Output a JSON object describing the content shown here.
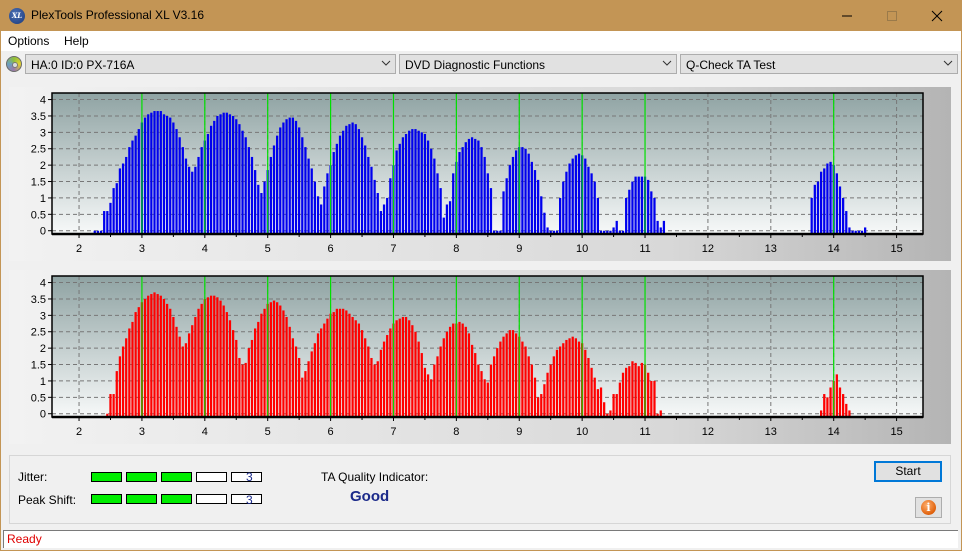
{
  "window": {
    "title": "PlexTools Professional XL V3.16",
    "icon": "plextools-xl-logo-icon",
    "icon_text": "XL",
    "controls": [
      "minimize-icon",
      "maximize-icon",
      "close-icon"
    ]
  },
  "menu": {
    "items": [
      {
        "label": "Options"
      },
      {
        "label": "Help"
      }
    ]
  },
  "toolbar": {
    "drive_icon": "disc-drive-icon",
    "drive_select": "HA:0 ID:0  PX-716A",
    "function_select": "DVD Diagnostic Functions",
    "test_select": "Q-Check TA Test"
  },
  "colors": {
    "titlebar": "#c39555",
    "top_bars": "#0000ee",
    "bottom_bars": "#ff0000",
    "reference_lines": "#00e000",
    "meter_on": "#00ee00",
    "quality_text": "#1b2a8a",
    "status_text": "#e00000"
  },
  "chart_data": [
    {
      "type": "bar",
      "name": "TA land (top)",
      "x_ticks": [
        "2",
        "3",
        "4",
        "5",
        "6",
        "7",
        "8",
        "9",
        "10",
        "11",
        "12",
        "13",
        "14",
        "15"
      ],
      "y_ticks": [
        "0",
        "0.5",
        "1",
        "1.5",
        "2",
        "2.5",
        "3",
        "3.5",
        "4"
      ],
      "xlim": [
        1.57,
        15.42
      ],
      "ylim": [
        -0.1,
        4.2
      ],
      "grid": true,
      "reference_lines_x": [
        3,
        4,
        5,
        6,
        7,
        8,
        9,
        10,
        11,
        14
      ],
      "bar_step": 0.05,
      "segments": [
        {
          "start": 2.25,
          "values": [
            0,
            0,
            0,
            0.6,
            0.6,
            0.85,
            1.3,
            1.45,
            1.9,
            2.05,
            2.25,
            2.55,
            2.75,
            2.9,
            3.1,
            3.3,
            3.45,
            3.55,
            3.6,
            3.65,
            3.65,
            3.65,
            3.55,
            3.5,
            3.45,
            3.3,
            3.1,
            2.85,
            2.55,
            2.2,
            1.95,
            1.8,
            1.95,
            2.25,
            2.55,
            2.75,
            2.95,
            3.2,
            3.35,
            3.5,
            3.55,
            3.6,
            3.6,
            3.55,
            3.5,
            3.4,
            3.25,
            3.05,
            2.85,
            2.55,
            2.25,
            1.85,
            1.4,
            1.15,
            1.5,
            1.85,
            2.25,
            2.6,
            2.9,
            3.15,
            3.3,
            3.4,
            3.45,
            3.45,
            3.35,
            3.15,
            2.85,
            2.55,
            2.2,
            1.9,
            1.5,
            1.05,
            0.8,
            1.35,
            1.75,
            2.0,
            2.4,
            2.65,
            2.9,
            3.05,
            3.2,
            3.25,
            3.3,
            3.25,
            3.1,
            2.85,
            2.6,
            2.25,
            1.95,
            1.55,
            1.15,
            0.6,
            0.8,
            1.0,
            1.6,
            2.0,
            2.45,
            2.65,
            2.85,
            2.95,
            3.05,
            3.1,
            3.1,
            3.05,
            3.0,
            2.95,
            2.75,
            2.5,
            2.2,
            1.75,
            1.3,
            0.4,
            0.8,
            0.9,
            1.75,
            2.1,
            2.4,
            2.55,
            2.7,
            2.8,
            2.85,
            2.8,
            2.75,
            2.55,
            2.25,
            1.75,
            1.3,
            0,
            0,
            0,
            1.2,
            1.6,
            2.0,
            2.25,
            2.45,
            2.55,
            2.55,
            2.5,
            2.35,
            2.1,
            1.85,
            1.55,
            1.05,
            0.55,
            0.1,
            0,
            0,
            0,
            1.0,
            1.5,
            1.8,
            2.05,
            2.2,
            2.3,
            2.35,
            2.3,
            2.2,
            1.95,
            1.75,
            1.5,
            1.0,
            0,
            0,
            0,
            0,
            0.1,
            0.3,
            0,
            0,
            1.0,
            1.25,
            1.5,
            1.65,
            1.65,
            1.65,
            1.65,
            1.55,
            1.2,
            1.0,
            0.3,
            0.1,
            0.3
          ]
        },
        {
          "start": 13.65,
          "values": [
            1.0,
            1.4,
            1.5,
            1.8,
            1.9,
            2.05,
            2.1,
            2.0,
            1.75,
            1.35,
            1.0,
            0.6,
            0.1,
            0,
            0,
            0,
            0,
            0.1
          ]
        }
      ]
    },
    {
      "type": "bar",
      "name": "TA groove (bottom)",
      "x_ticks": [
        "2",
        "3",
        "4",
        "5",
        "6",
        "7",
        "8",
        "9",
        "10",
        "11",
        "12",
        "13",
        "14",
        "15"
      ],
      "y_ticks": [
        "0",
        "0.5",
        "1",
        "1.5",
        "2",
        "2.5",
        "3",
        "3.5",
        "4"
      ],
      "xlim": [
        1.57,
        15.42
      ],
      "ylim": [
        -0.1,
        4.2
      ],
      "grid": true,
      "reference_lines_x": [
        3,
        4,
        5,
        6,
        7,
        8,
        9,
        10,
        11,
        14
      ],
      "bar_step": 0.05,
      "segments": [
        {
          "start": 2.45,
          "values": [
            0,
            0.6,
            0.6,
            1.3,
            1.75,
            2.05,
            2.3,
            2.6,
            2.8,
            3.1,
            3.25,
            3.4,
            3.5,
            3.6,
            3.65,
            3.7,
            3.65,
            3.6,
            3.5,
            3.35,
            3.2,
            2.95,
            2.65,
            2.35,
            2.05,
            2.15,
            2.45,
            2.7,
            2.95,
            3.2,
            3.35,
            3.5,
            3.55,
            3.6,
            3.6,
            3.55,
            3.45,
            3.3,
            3.1,
            2.85,
            2.55,
            2.25,
            1.7,
            1.5,
            1.55,
            2.0,
            2.25,
            2.6,
            2.8,
            3.05,
            3.2,
            3.35,
            3.4,
            3.45,
            3.4,
            3.3,
            3.15,
            2.95,
            2.65,
            2.3,
            2.05,
            1.7,
            1.1,
            1.3,
            1.6,
            1.9,
            2.15,
            2.45,
            2.6,
            2.75,
            2.9,
            3.05,
            3.1,
            3.2,
            3.2,
            3.2,
            3.15,
            3.05,
            2.95,
            2.85,
            2.75,
            2.55,
            2.3,
            2.05,
            1.7,
            1.5,
            1.6,
            1.95,
            2.2,
            2.4,
            2.6,
            2.75,
            2.85,
            2.9,
            2.95,
            2.95,
            2.85,
            2.7,
            2.5,
            2.2,
            1.85,
            1.4,
            1.2,
            1.05,
            1.5,
            1.75,
            2.05,
            2.3,
            2.5,
            2.65,
            2.75,
            2.75,
            2.8,
            2.75,
            2.65,
            2.45,
            2.1,
            1.85,
            1.5,
            1.3,
            1.05,
            0.95,
            1.5,
            1.75,
            2.0,
            2.2,
            2.35,
            2.45,
            2.55,
            2.55,
            2.45,
            2.35,
            2.2,
            2.05,
            1.75,
            1.5,
            1.1,
            0.5,
            0.6,
            0.9,
            1.25,
            1.5,
            1.75,
            1.95,
            2.05,
            2.15,
            2.25,
            2.3,
            2.35,
            2.3,
            2.2,
            2.15,
            1.95,
            1.7,
            1.4,
            1.1,
            0.75,
            0.8,
            0.35,
            0,
            0.1,
            0.6,
            0.6,
            0.95,
            1.25,
            1.4,
            1.45,
            1.6,
            1.55,
            1.45,
            1.55,
            1.5,
            1.25,
            1.0,
            1.0,
            0,
            0.1
          ]
        },
        {
          "start": 13.8,
          "values": [
            0.1,
            0.6,
            0.5,
            0.8,
            1.0,
            1.2,
            0.8,
            0.6,
            0.3,
            0.1
          ]
        }
      ]
    }
  ],
  "results": {
    "jitter_label": "Jitter:",
    "jitter_value": "3",
    "jitter_level": 3,
    "peak_shift_label": "Peak Shift:",
    "peak_shift_value": "3",
    "peak_shift_level": 3,
    "meter_max": 5,
    "ta_quality_label": "TA Quality Indicator:",
    "ta_quality_value": "Good"
  },
  "buttons": {
    "start": "Start",
    "info_icon": "info-icon"
  },
  "status": {
    "text": "Ready"
  }
}
